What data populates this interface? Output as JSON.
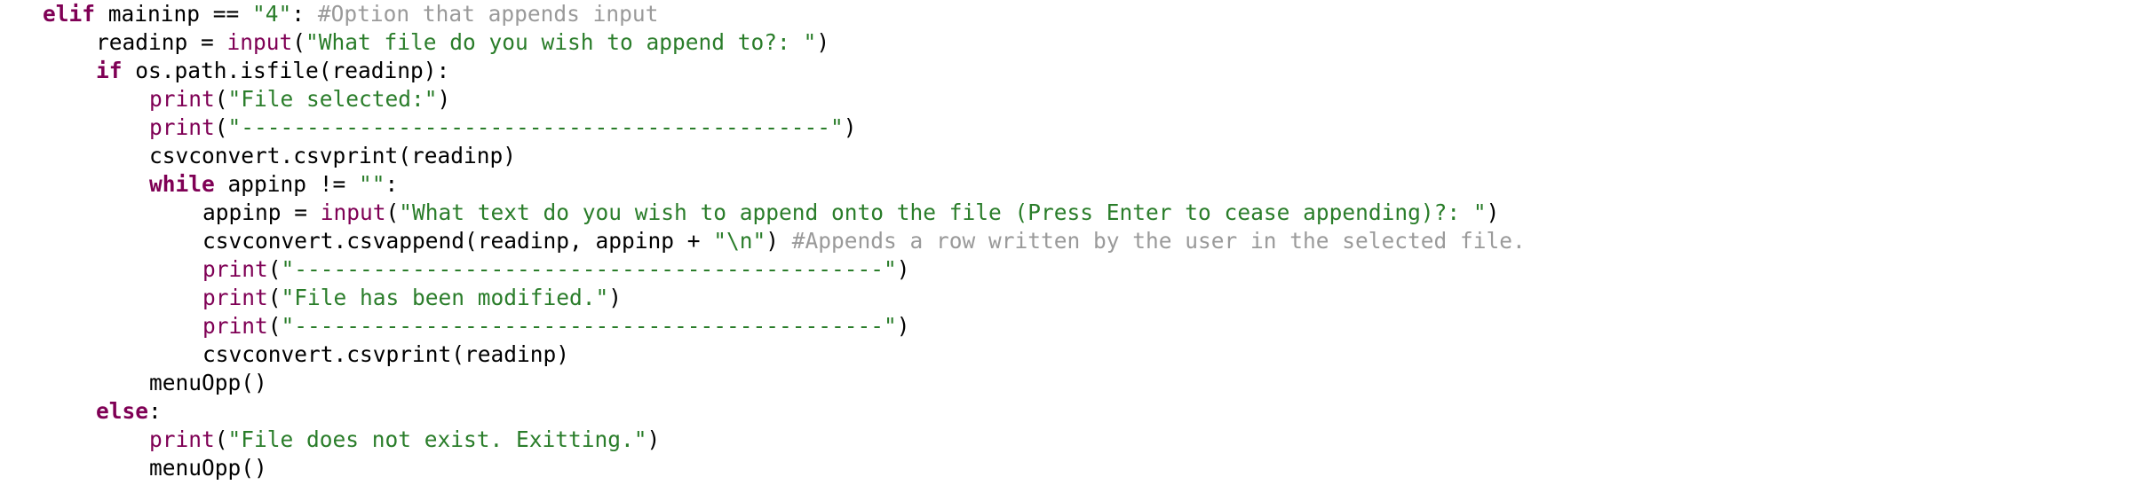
{
  "editor": {
    "lines": [
      {
        "indent": 0,
        "tokens": [
          {
            "t": "keyword",
            "v": "elif"
          },
          {
            "t": "plain",
            "v": " maininp == "
          },
          {
            "t": "string",
            "v": "\"4\""
          },
          {
            "t": "plain",
            "v": ": "
          },
          {
            "t": "comment",
            "v": "#Option that appends input"
          }
        ]
      },
      {
        "indent": 4,
        "tokens": [
          {
            "t": "plain",
            "v": "readinp = "
          },
          {
            "t": "builtin",
            "v": "input"
          },
          {
            "t": "plain",
            "v": "("
          },
          {
            "t": "string",
            "v": "\"What file do you wish to append to?: \""
          },
          {
            "t": "plain",
            "v": ")"
          }
        ]
      },
      {
        "indent": 4,
        "tokens": [
          {
            "t": "keyword",
            "v": "if"
          },
          {
            "t": "plain",
            "v": " os.path.isfile(readinp):"
          }
        ]
      },
      {
        "indent": 8,
        "tokens": [
          {
            "t": "builtin",
            "v": "print"
          },
          {
            "t": "plain",
            "v": "("
          },
          {
            "t": "string",
            "v": "\"File selected:\""
          },
          {
            "t": "plain",
            "v": ")"
          }
        ]
      },
      {
        "indent": 8,
        "tokens": [
          {
            "t": "builtin",
            "v": "print"
          },
          {
            "t": "plain",
            "v": "("
          },
          {
            "t": "string",
            "v": "\"---------------------------------------------\""
          },
          {
            "t": "plain",
            "v": ")"
          }
        ]
      },
      {
        "indent": 8,
        "tokens": [
          {
            "t": "plain",
            "v": "csvconvert.csvprint(readinp)"
          }
        ]
      },
      {
        "indent": 8,
        "tokens": [
          {
            "t": "keyword",
            "v": "while"
          },
          {
            "t": "plain",
            "v": " appinp != "
          },
          {
            "t": "string",
            "v": "\"\""
          },
          {
            "t": "plain",
            "v": ":"
          }
        ]
      },
      {
        "indent": 12,
        "tokens": [
          {
            "t": "plain",
            "v": "appinp = "
          },
          {
            "t": "builtin",
            "v": "input"
          },
          {
            "t": "plain",
            "v": "("
          },
          {
            "t": "string",
            "v": "\"What text do you wish to append onto the file (Press Enter to cease appending)?: \""
          },
          {
            "t": "plain",
            "v": ")"
          }
        ]
      },
      {
        "indent": 12,
        "tokens": [
          {
            "t": "plain",
            "v": "csvconvert.csvappend(readinp, appinp + "
          },
          {
            "t": "string",
            "v": "\"\\n\""
          },
          {
            "t": "plain",
            "v": ") "
          },
          {
            "t": "comment",
            "v": "#Appends a row written by the user in the selected file."
          }
        ]
      },
      {
        "indent": 12,
        "tokens": [
          {
            "t": "builtin",
            "v": "print"
          },
          {
            "t": "plain",
            "v": "("
          },
          {
            "t": "string",
            "v": "\"---------------------------------------------\""
          },
          {
            "t": "plain",
            "v": ")"
          }
        ]
      },
      {
        "indent": 12,
        "tokens": [
          {
            "t": "builtin",
            "v": "print"
          },
          {
            "t": "plain",
            "v": "("
          },
          {
            "t": "string",
            "v": "\"File has been modified.\""
          },
          {
            "t": "plain",
            "v": ")"
          }
        ]
      },
      {
        "indent": 12,
        "tokens": [
          {
            "t": "builtin",
            "v": "print"
          },
          {
            "t": "plain",
            "v": "("
          },
          {
            "t": "string",
            "v": "\"---------------------------------------------\""
          },
          {
            "t": "plain",
            "v": ")"
          }
        ]
      },
      {
        "indent": 12,
        "tokens": [
          {
            "t": "plain",
            "v": "csvconvert.csvprint(readinp)"
          }
        ]
      },
      {
        "indent": 8,
        "tokens": [
          {
            "t": "plain",
            "v": "menuOpp()"
          }
        ]
      },
      {
        "indent": 4,
        "tokens": [
          {
            "t": "keyword",
            "v": "else"
          },
          {
            "t": "plain",
            "v": ":"
          }
        ]
      },
      {
        "indent": 8,
        "tokens": [
          {
            "t": "builtin",
            "v": "print"
          },
          {
            "t": "plain",
            "v": "("
          },
          {
            "t": "string",
            "v": "\"File does not exist. Exitting.\""
          },
          {
            "t": "plain",
            "v": ")"
          }
        ]
      },
      {
        "indent": 8,
        "tokens": [
          {
            "t": "plain",
            "v": "menuOpp()"
          }
        ]
      }
    ]
  },
  "colors": {
    "keyword": "#7f0055",
    "builtin": "#7f0055",
    "string": "#2a7d2a",
    "comment": "#9a9a9a",
    "plain": "#000000",
    "background": "#ffffff"
  }
}
